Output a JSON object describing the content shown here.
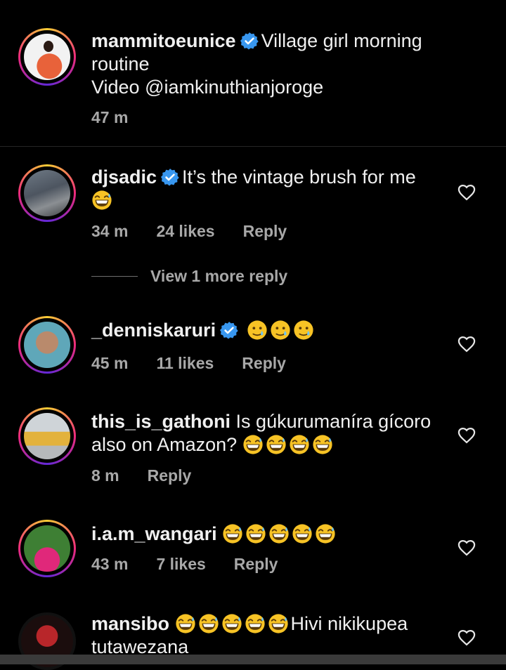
{
  "caption": {
    "username": "mammitoeunice",
    "text": "Village girl morning routine",
    "subtext": "Video @iamkinuthianjoroge",
    "time": "47 m"
  },
  "comments": [
    {
      "username": "djsadic",
      "text": "It’s the vintage brush for me",
      "emoji_count": 1,
      "time": "34 m",
      "likes": "24 likes",
      "reply": "Reply"
    },
    {
      "username": "_denniskaruri",
      "text": "",
      "emoji_count": 3,
      "time": "45 m",
      "likes": "11 likes",
      "reply": "Reply"
    },
    {
      "username": "this_is_gathoni",
      "text": "Is gúkurumaníra gícoro also on Amazon?",
      "emoji_count": 4,
      "time": "8 m",
      "likes": "",
      "reply": "Reply"
    },
    {
      "username": "i.a.m_wangari",
      "text": "",
      "emoji_count": 5,
      "time": "43 m",
      "likes": "7 likes",
      "reply": "Reply"
    },
    {
      "username": "mansibo",
      "text": "Hivi nikikupea tutawezana",
      "emoji_count": 5
    }
  ],
  "view_more": "View 1 more reply",
  "colors": {
    "verified": "#3897f0",
    "emoji": "#f7c325",
    "muted": "#a8a8a8"
  },
  "icons": [
    "verified-badge-icon",
    "heart-outline-icon",
    "grin-sweat-emoji",
    "smiling-tear-emoji"
  ]
}
